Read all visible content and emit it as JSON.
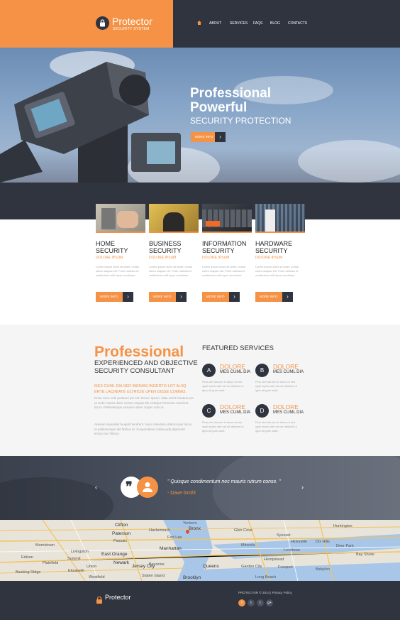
{
  "header": {
    "logo_title": "Protector",
    "logo_subtitle": "SECURITY SYSTEM",
    "nav": [
      "ABOUT",
      "SERVICES",
      "FAQS",
      "BLOG",
      "CONTACTS"
    ]
  },
  "hero": {
    "line1": "Professional",
    "line2": "Powerful",
    "line3": "SECURITY PROTECTION",
    "button": "MORE INFO"
  },
  "services": [
    {
      "title1": "HOME",
      "title2": "SECURITY",
      "sub": "DOLORE IPSUM",
      "text": "Lorem ipsum dolor sit amet, conse ctetur adipisc elit. Proin ultricies et vestibulum velit byus condimen.",
      "button": "MORE INFO"
    },
    {
      "title1": "BUSINESS",
      "title2": "SECURITY",
      "sub": "DOLORE IPSUM",
      "text": "Lorem ipsum dolor sit amet, conse ctetur adipisc elit. Proin ultricies et vestibulum velit byus condimen.",
      "button": "MORE INFO"
    },
    {
      "title1": "INFORMATION",
      "title2": "SECURITY",
      "sub": "DOLORE IPSUM",
      "text": "Lorem ipsum dolor sit amet, conse ctetur adipisc elit. Proin ultricies et vestibulum velit byus condimen.",
      "button": "MORE INFO"
    },
    {
      "title1": "HARDWARE",
      "title2": "SECURITY",
      "sub": "DOLORE IPSUM",
      "text": "Lorem ipsum dolor sit amet, conse ctetur adipisc elit. Proin ultricies et vestibulum velit byus condimen.",
      "button": "MORE INFO"
    }
  ],
  "about": {
    "title": "Professional",
    "subtitle1": "EXPERIENCED AND OBJECTIVE",
    "subtitle2": "SECURITY CONSULTANT",
    "orange1": "MES CUML DIA SED INENIAS INGERTO LOT ALIIQ",
    "orange2": "ERTE LACINIATE ULTRICIE UPEN DISSE COMMO.",
    "text1": "Dolor nunc vule putateur ips elit. Donec ipsum, vitae amet intuatus pre ut sede massa dolor conset sequat elit, tristique fermentu nasciturt lacus. Pellentesque posuere ullam corper odio ut.",
    "text2": "Aenean imperdiet feugiat hendrerit. Nunc interdum ullamcorper lacus et pellentesque elit finibus et. Suspendisse malesuada dignissim lectus nec finibus."
  },
  "featured": {
    "title": "FEATURED SERVICES",
    "items": [
      {
        "letter": "A",
        "head": "DOLORE",
        "sub": "MES CUML DIA",
        "text": "Pelu ulet dia sed in lacus ut eris ugdt mpelu ade est de aeliscet ul igna utt gule sade."
      },
      {
        "letter": "B",
        "head": "DOLORE",
        "sub": "MES CUML DIA",
        "text": "Pelu ulet dia sed in lacus ut eris ugdt mpelu ade est de aeliscet ul igna utt gule sade."
      },
      {
        "letter": "C",
        "head": "DOLORE",
        "sub": "MES CUML DIA",
        "text": "Pelu ulet dia sed in lacus ut eris ugdt mpelu ade est de aeliscet ul igna utt gule sade."
      },
      {
        "letter": "D",
        "head": "DOLORE",
        "sub": "MES CUML DIA",
        "text": "Pelu ulet dia sed in lacus ut eris ugdt mpelu ade est de aeliscet ul igna utt gule sade."
      }
    ]
  },
  "testimonial": {
    "quote": "\" Quisque condimentum nec mauris rutrum conse. \"",
    "author": "- Dave Grohl",
    "prev": "‹",
    "next": "›"
  },
  "map_labels": [
    "Clifton",
    "Paterson",
    "Bronx",
    "Syosset",
    "Morristown",
    "Bayonne",
    "Manhattan",
    "Passaic",
    "East Orange",
    "Newark",
    "Jersey City",
    "Queens",
    "Brooklyn",
    "Livingston",
    "Union",
    "Plainfield",
    "Basking Ridge",
    "Elizabeth",
    "Garden City",
    "Hempstead",
    "Freeport",
    "Levittown",
    "Deer Park",
    "Bay Shore",
    "Babylon",
    "Long Beach",
    "Huntington",
    "Mineola",
    "Hicksville",
    "Yonkers",
    "Hackensack",
    "Fort Lee",
    "Staten Island",
    "Edison",
    "Summit",
    "Westfield",
    "Glen Cove",
    "Dix Hills"
  ],
  "footer": {
    "logo": "Protector",
    "copyright": "PROTECTOR © 2014 | Privacy Policy",
    "social": [
      "f",
      "t",
      "t",
      "g+"
    ]
  },
  "colors": {
    "accent": "#f59245",
    "dark": "#2f343e"
  },
  "icons": {
    "logo": "lock-icon",
    "home": "home-icon"
  }
}
